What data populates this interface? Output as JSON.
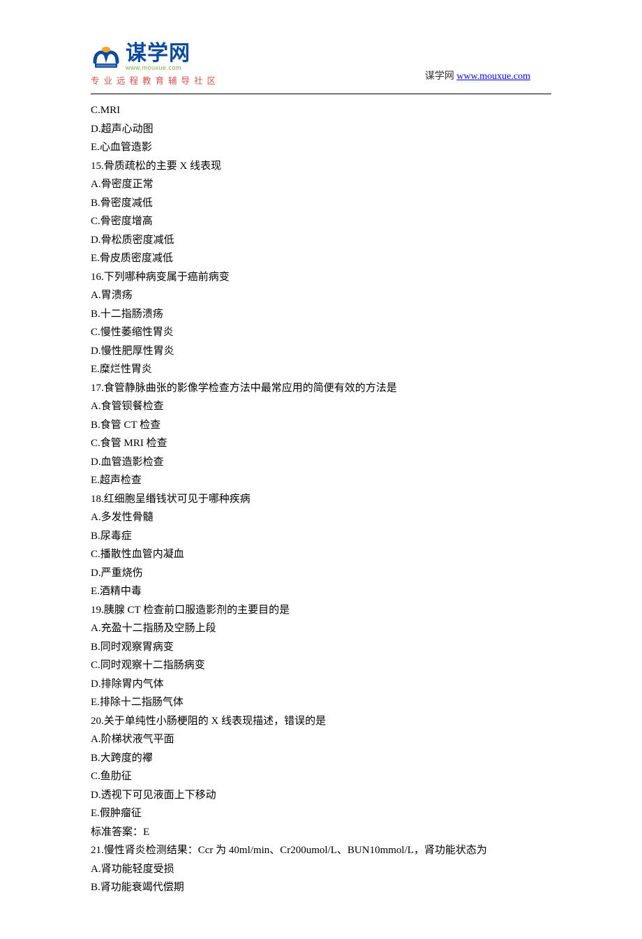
{
  "header": {
    "logo_cn": "谋学网",
    "logo_en": "www.mouxue.com",
    "logo_sub": "专业远程教育辅导社区",
    "right_prefix": "谋学网 ",
    "right_link": "www.mouxue.com"
  },
  "lines": [
    "C.MRI",
    "D.超声心动图",
    "E.心血管造影",
    "15.骨质疏松的主要 X 线表现",
    "A.骨密度正常",
    "B.骨密度减低",
    "C.骨密度增高",
    "D.骨松质密度减低",
    "E.骨皮质密度减低",
    "16.下列哪种病变属于癌前病变",
    "A.胃溃疡",
    "B.十二指肠溃疡",
    "C.慢性萎缩性胃炎",
    "D.慢性肥厚性胃炎",
    "E.糜烂性胃炎",
    "17.食管静脉曲张的影像学检查方法中最常应用的简便有效的方法是",
    "A.食管钡餐检查",
    "B.食管 CT 检查",
    "C.食管 MRI 检查",
    "D.血管造影检查",
    "E.超声检查",
    "18.红细胞呈缗钱状可见于哪种疾病",
    "A.多发性骨髓",
    "B.尿毒症",
    "C.播散性血管内凝血",
    "D.严重烧伤",
    "E.酒精中毒",
    "19.胰腺 CT 检查前口服造影剂的主要目的是",
    "A.充盈十二指肠及空肠上段",
    "B.同时观察胃病变",
    "C.同时观察十二指肠病变",
    "D.排除胃内气体",
    "E.排除十二指肠气体",
    "20.关于单纯性小肠梗阻的 X 线表现描述，错误的是",
    "A.阶梯状液气平面",
    "B.大跨度的襻",
    "C.鱼肋征",
    "D.透视下可见液面上下移动",
    "E.假肿瘤征",
    "标准答案：E",
    "21.慢性肾炎检测结果：Ccr 为 40ml/min、Cr200umol/L、BUN10mmol/L，肾功能状态为",
    "A.肾功能轻度受损",
    "B.肾功能衰竭代偿期"
  ]
}
